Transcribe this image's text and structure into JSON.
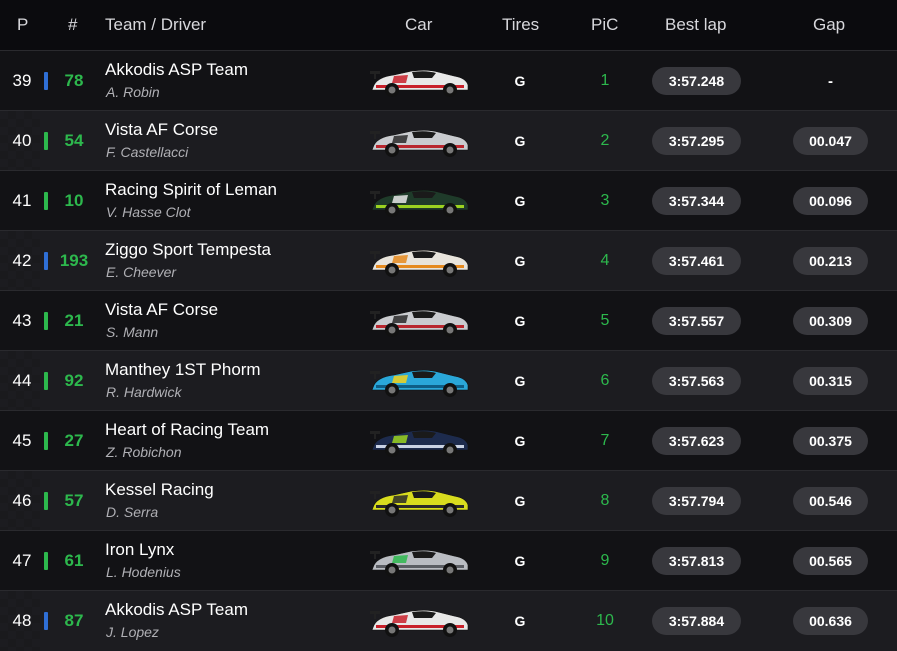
{
  "header": {
    "p": "P",
    "num": "#",
    "team": "Team / Driver",
    "car": "Car",
    "tires": "Tires",
    "pic": "PiC",
    "best": "Best lap",
    "gap": "Gap"
  },
  "colors": {
    "accent_green": "#2db84d",
    "class_blue": "#2f6fd6",
    "class_green": "#2db84d"
  },
  "rows": [
    {
      "pos": "39",
      "class_color": "#2f6fd6",
      "num": "78",
      "team": "Akkodis ASP Team",
      "driver": "A. Robin",
      "car_icon": "lexus-red-white-car",
      "tires": "G",
      "pic": "1",
      "best": "3:57.248",
      "gap": "-"
    },
    {
      "pos": "40",
      "class_color": "#2db84d",
      "num": "54",
      "team": "Vista AF Corse",
      "driver": "F. Castellacci",
      "car_icon": "ferrari-silver-car",
      "tires": "G",
      "pic": "2",
      "best": "3:57.295",
      "gap": "00.047"
    },
    {
      "pos": "41",
      "class_color": "#2db84d",
      "num": "10",
      "team": "Racing Spirit of Leman",
      "driver": "V. Hasse Clot",
      "car_icon": "aston-martin-green-car",
      "tires": "G",
      "pic": "3",
      "best": "3:57.344",
      "gap": "00.096"
    },
    {
      "pos": "42",
      "class_color": "#2f6fd6",
      "num": "193",
      "team": "Ziggo Sport Tempesta",
      "driver": "E. Cheever",
      "car_icon": "ferrari-orange-car",
      "tires": "G",
      "pic": "4",
      "best": "3:57.461",
      "gap": "00.213"
    },
    {
      "pos": "43",
      "class_color": "#2db84d",
      "num": "21",
      "team": "Vista AF Corse",
      "driver": "S. Mann",
      "car_icon": "ferrari-silver-car",
      "tires": "G",
      "pic": "5",
      "best": "3:57.557",
      "gap": "00.309"
    },
    {
      "pos": "44",
      "class_color": "#2db84d",
      "num": "92",
      "team": "Manthey 1ST Phorm",
      "driver": "R. Hardwick",
      "car_icon": "porsche-blue-car",
      "tires": "G",
      "pic": "6",
      "best": "3:57.563",
      "gap": "00.315"
    },
    {
      "pos": "45",
      "class_color": "#2db84d",
      "num": "27",
      "team": "Heart of Racing Team",
      "driver": "Z. Robichon",
      "car_icon": "aston-martin-navy-car",
      "tires": "G",
      "pic": "7",
      "best": "3:57.623",
      "gap": "00.375"
    },
    {
      "pos": "46",
      "class_color": "#2db84d",
      "num": "57",
      "team": "Kessel Racing",
      "driver": "D. Serra",
      "car_icon": "ferrari-yellow-car",
      "tires": "G",
      "pic": "8",
      "best": "3:57.794",
      "gap": "00.546"
    },
    {
      "pos": "47",
      "class_color": "#2db84d",
      "num": "61",
      "team": "Iron Lynx",
      "driver": "L. Hodenius",
      "car_icon": "mercedes-silver-car",
      "tires": "G",
      "pic": "9",
      "best": "3:57.813",
      "gap": "00.565"
    },
    {
      "pos": "48",
      "class_color": "#2f6fd6",
      "num": "87",
      "team": "Akkodis ASP Team",
      "driver": "J. Lopez",
      "car_icon": "lexus-red-white-car",
      "tires": "G",
      "pic": "10",
      "best": "3:57.884",
      "gap": "00.636"
    }
  ]
}
